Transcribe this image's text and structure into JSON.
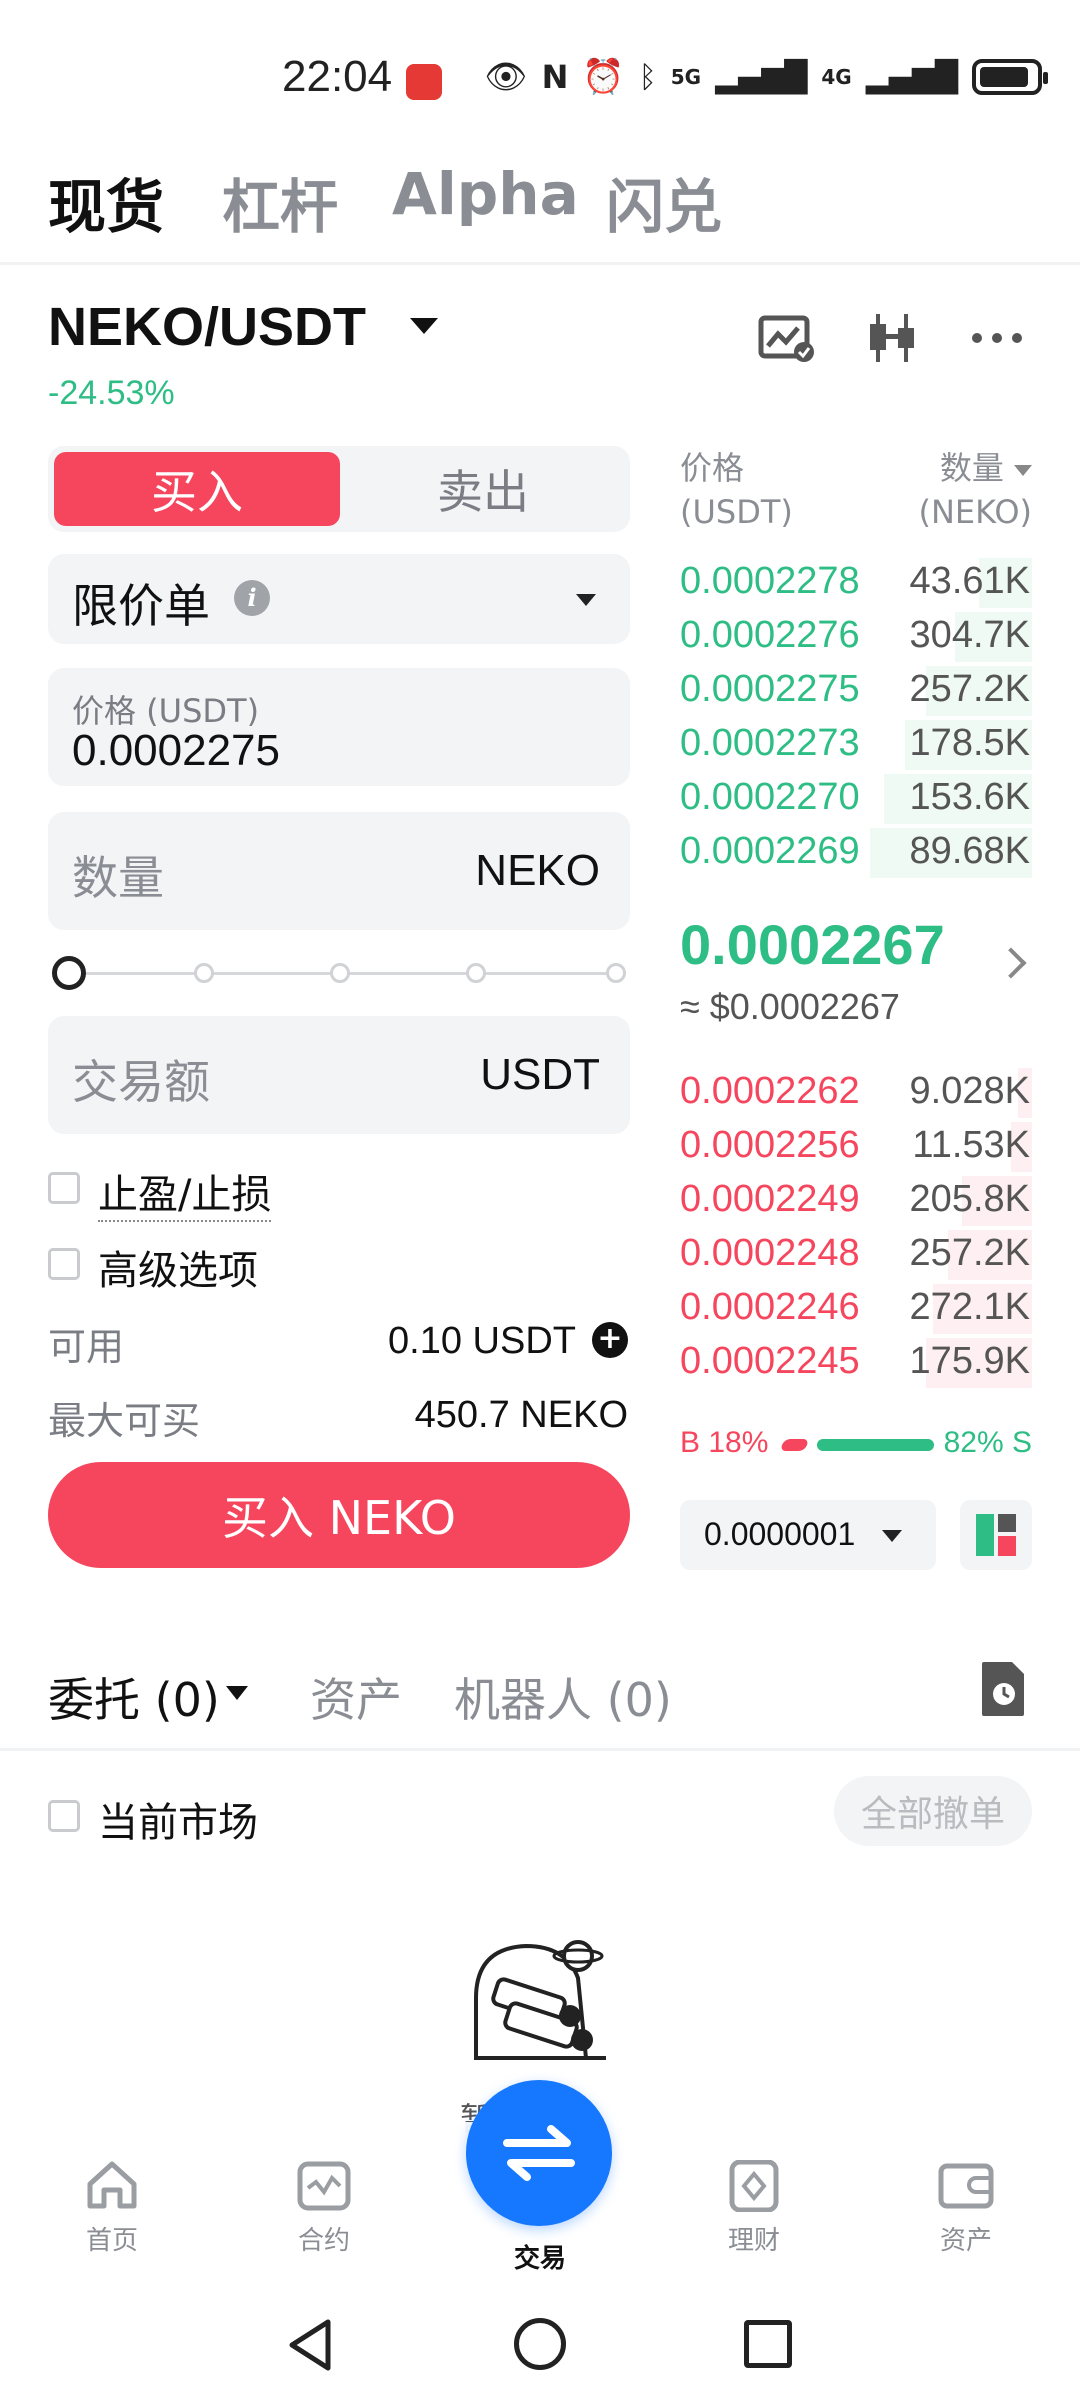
{
  "status_bar": {
    "time": "22:04",
    "network_1": "5G",
    "network_2": "4G"
  },
  "top_tabs": [
    {
      "label": "现货",
      "active": true
    },
    {
      "label": "杠杆",
      "active": false
    },
    {
      "label": "Alpha",
      "active": false
    },
    {
      "label": "闪兑",
      "active": false
    }
  ],
  "pair": {
    "name": "NEKO/USDT",
    "change": "-24.53%"
  },
  "toggle": {
    "buy": "买入",
    "sell": "卖出"
  },
  "order_type": "限价单",
  "price_field": {
    "label": "价格 (USDT)",
    "value": "0.0002275"
  },
  "qty_field": {
    "placeholder": "数量",
    "unit": "NEKO"
  },
  "slider_level": 0,
  "amount_field": {
    "placeholder": "交易额",
    "unit": "USDT"
  },
  "options": {
    "tp_sl": "止盈/止损",
    "advanced": "高级选项"
  },
  "available": {
    "label": "可用",
    "value": "0.10 USDT"
  },
  "max_buy": {
    "label": "最大可买",
    "value": "450.7 NEKO"
  },
  "buy_button": "买入 NEKO",
  "orderbook": {
    "price_header": "价格",
    "price_unit": "(USDT)",
    "qty_header": "数量",
    "qty_unit": "(NEKO)",
    "asks": [
      {
        "price": "0.0002278",
        "qty": "43.61K",
        "depth": 0.15
      },
      {
        "price": "0.0002276",
        "qty": "304.7K",
        "depth": 0.22
      },
      {
        "price": "0.0002275",
        "qty": "257.2K",
        "depth": 0.3
      },
      {
        "price": "0.0002273",
        "qty": "178.5K",
        "depth": 0.36
      },
      {
        "price": "0.0002270",
        "qty": "153.6K",
        "depth": 0.42
      },
      {
        "price": "0.0002269",
        "qty": "89.68K",
        "depth": 0.46
      }
    ],
    "last_price": "0.0002267",
    "last_price_usd": "≈ $0.0002267",
    "bids": [
      {
        "price": "0.0002262",
        "qty": "9.028K",
        "depth": 0.04
      },
      {
        "price": "0.0002256",
        "qty": "11.53K",
        "depth": 0.06
      },
      {
        "price": "0.0002249",
        "qty": "205.8K",
        "depth": 0.2
      },
      {
        "price": "0.0002248",
        "qty": "257.2K",
        "depth": 0.24
      },
      {
        "price": "0.0002246",
        "qty": "272.1K",
        "depth": 0.28
      },
      {
        "price": "0.0002245",
        "qty": "175.9K",
        "depth": 0.3
      }
    ],
    "buy_ratio": "B 18%",
    "sell_ratio": "82% S",
    "buy_fraction": 0.18,
    "precision": "0.0000001"
  },
  "section_tabs": [
    {
      "label": "委托 (0)",
      "active": true
    },
    {
      "label": "资产",
      "active": false
    },
    {
      "label": "机器人 (0)",
      "active": false
    }
  ],
  "current_market": "当前市场",
  "cancel_all": "全部撤单",
  "empty_text": "暂无委托",
  "bottom_nav": [
    {
      "label": "首页",
      "icon": "home-icon"
    },
    {
      "label": "合约",
      "icon": "futures-icon"
    },
    {
      "label": "交易",
      "icon": "swap-icon",
      "active": true
    },
    {
      "label": "理财",
      "icon": "earn-icon"
    },
    {
      "label": "资产",
      "icon": "wallet-icon"
    }
  ],
  "colors": {
    "buy": "#f6465d",
    "sell": "#2ebd85",
    "accent": "#1677ff"
  }
}
